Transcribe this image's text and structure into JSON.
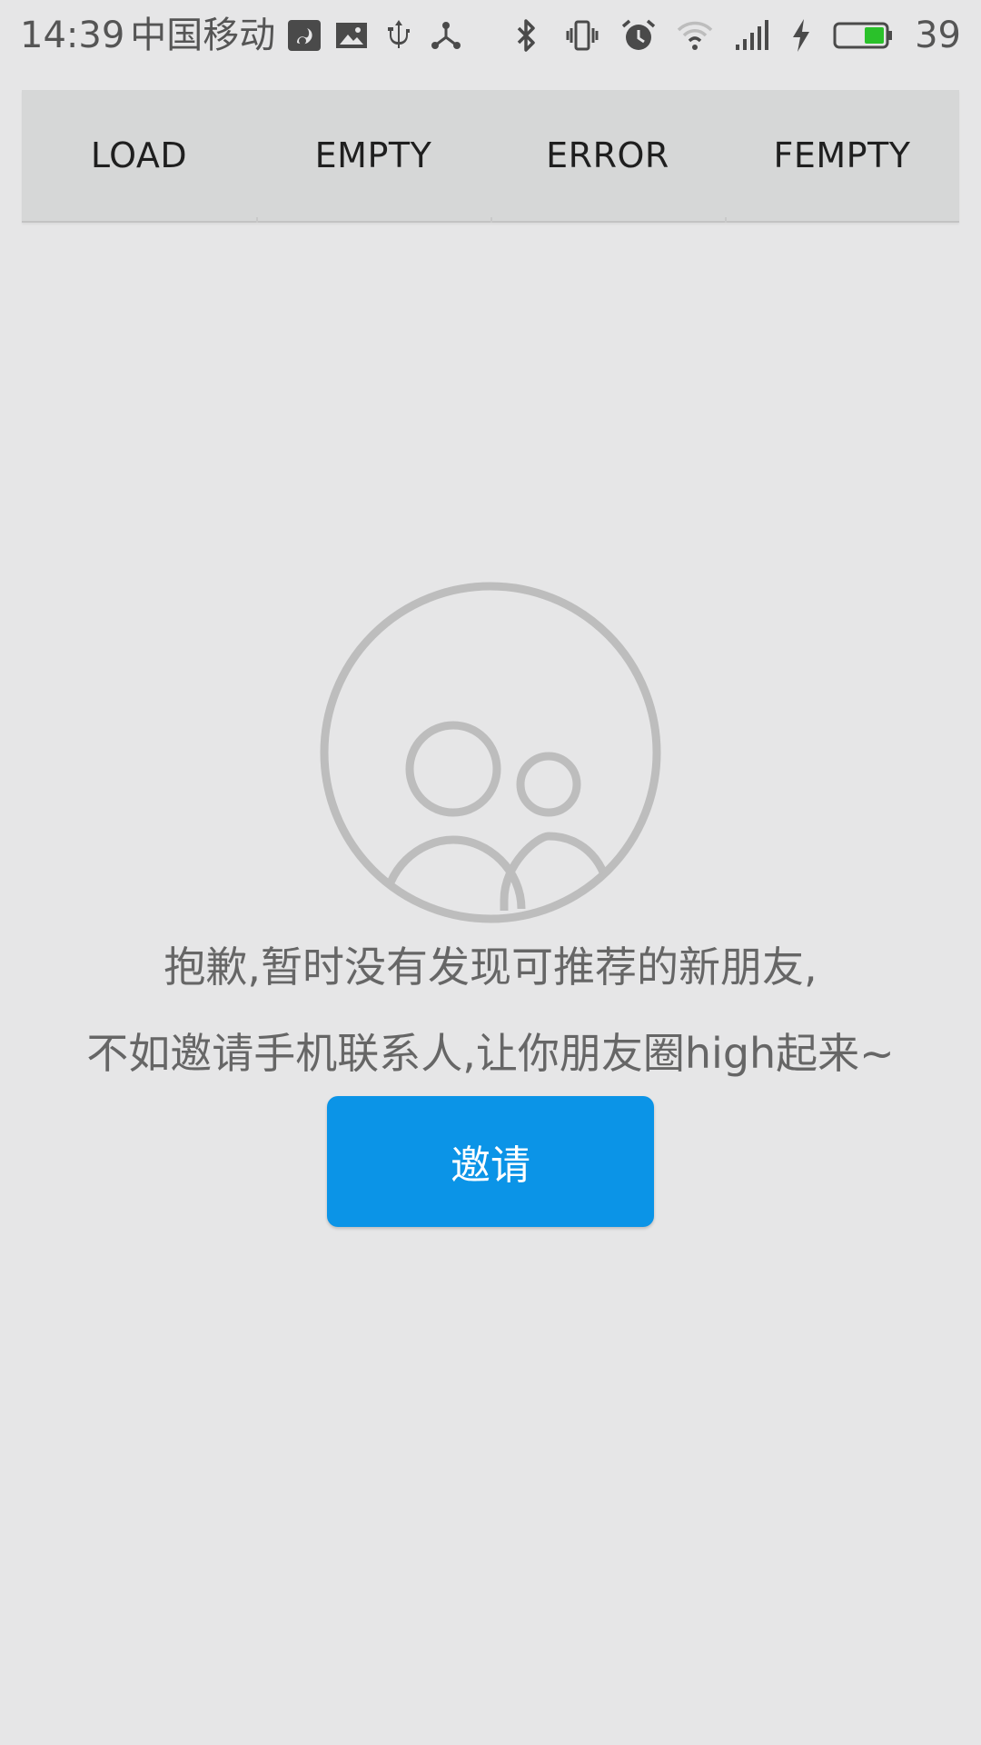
{
  "status_bar": {
    "time": "14:39",
    "carrier": "中国移动",
    "battery_level": "39",
    "battery_color": "#2ac12a",
    "left_icons": [
      "uc-browser-icon",
      "image-icon",
      "usb-icon",
      "share-icon"
    ],
    "right_icons": [
      "bluetooth-icon",
      "vibrate-icon",
      "alarm-icon",
      "wifi-icon",
      "signal-icon",
      "charging-icon",
      "battery-icon"
    ]
  },
  "tabs": [
    {
      "label": "LOAD"
    },
    {
      "label": "EMPTY"
    },
    {
      "label": "ERROR"
    },
    {
      "label": "FEMPTY"
    }
  ],
  "empty_state": {
    "icon": "friends-icon",
    "message_line_1": "抱歉,暂时没有发现可推荐的新朋友,",
    "message_line_2": "不如邀请手机联系人,让你朋友圈high起来~",
    "invite_label": "邀请"
  },
  "colors": {
    "background": "#e6e6e7",
    "tab_bar": "#d6d7d7",
    "button": "#0b94e7",
    "illustration": "#bdbdbd"
  }
}
